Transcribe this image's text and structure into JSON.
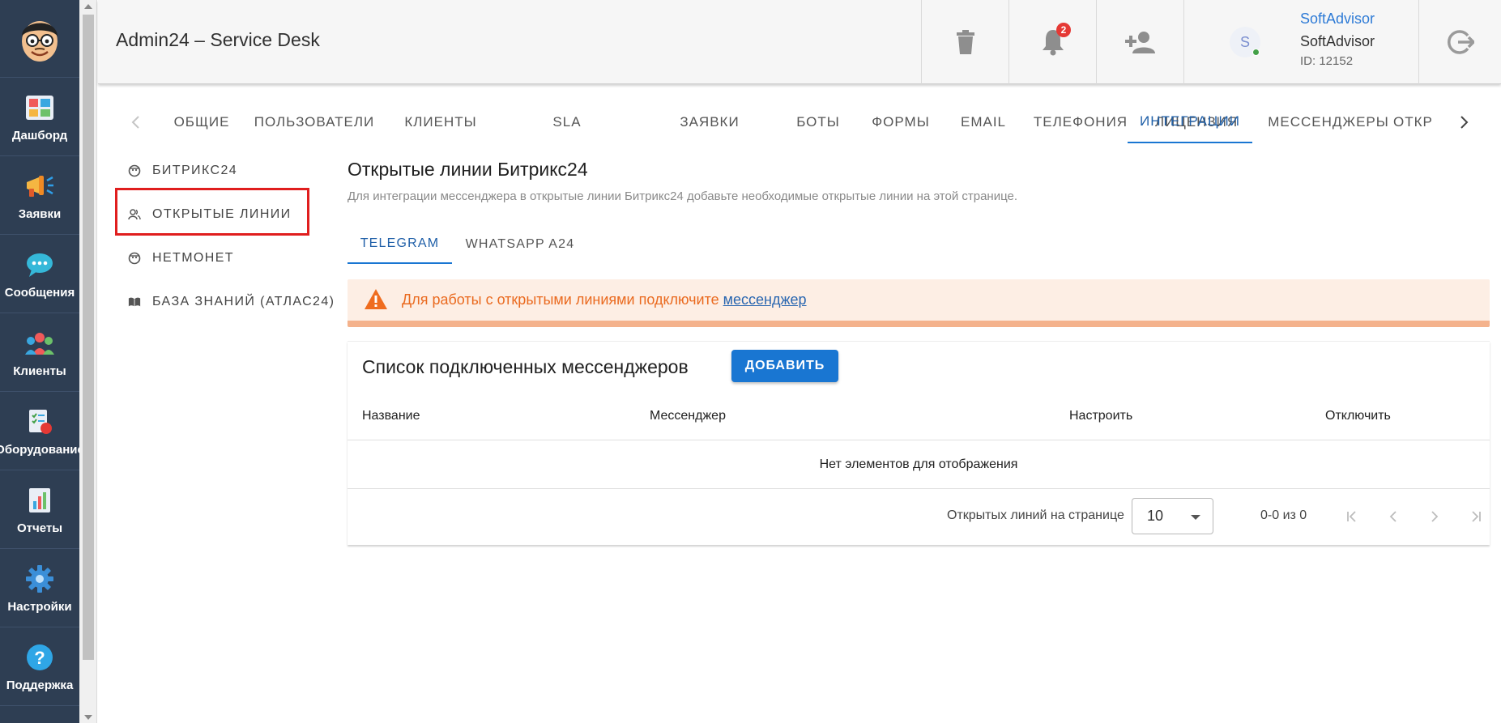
{
  "app": {
    "title": "Admin24 – Service Desk"
  },
  "sidebar": {
    "items": [
      {
        "label": "Дашборд",
        "icon": "dashboard-icon"
      },
      {
        "label": "Заявки",
        "icon": "megaphone-icon"
      },
      {
        "label": "Сообщения",
        "icon": "chat-bubble-icon"
      },
      {
        "label": "Клиенты",
        "icon": "clients-group-icon"
      },
      {
        "label": "Оборудование",
        "icon": "equipment-checklist-icon"
      },
      {
        "label": "Отчеты",
        "icon": "report-chart-icon"
      },
      {
        "label": "Настройки",
        "icon": "gear-icon"
      },
      {
        "label": "Поддержка",
        "icon": "help-icon"
      }
    ]
  },
  "header": {
    "notifications_count": "2",
    "user": {
      "avatar_letter": "S",
      "link_name": "SoftAdvisor",
      "name": "SoftAdvisor",
      "id": "ID: 12152"
    }
  },
  "tabs": [
    "ОБЩИЕ",
    "ПОЛЬЗОВАТЕЛИ",
    "КЛИЕНТЫ",
    "SLA",
    "ЗАЯВКИ",
    "БОТЫ",
    "ФОРМЫ",
    "EMAIL",
    "ТЕЛЕФОНИЯ",
    "ЛИЦЕНЗИЯ",
    "ИНТЕГРАЦИИ",
    "МЕССЕНДЖЕРЫ",
    "ОТКР"
  ],
  "active_tab": "ИНТЕГРАЦИИ",
  "subnav": [
    {
      "label": "БИТРИКС24",
      "icon": "bitrix-icon"
    },
    {
      "label": "ОТКРЫТЫЕ ЛИНИИ",
      "icon": "users-icon"
    },
    {
      "label": "НЕТМОНЕТ",
      "icon": "netmonet-icon"
    },
    {
      "label": "БАЗА ЗНАНИЙ (АТЛАС24)",
      "icon": "book-icon"
    }
  ],
  "content": {
    "title": "Открытые линии Битрикс24",
    "description": "Для интеграции мессенджера в открытые линии Битрикс24 добавьте необходимые открытые линии на этой странице.",
    "inner_tabs": [
      "TELEGRAM",
      "WHATSAPP A24"
    ],
    "alert": {
      "text": "Для работы с открытыми линиями подключите ",
      "link": "мессенджер"
    },
    "list": {
      "title": "Список подключенных мессенджеров",
      "add_button": "ДОБАВИТЬ",
      "columns": [
        "Название",
        "Мессенджер",
        "Настроить",
        "Отключить"
      ],
      "empty_text": "Нет элементов для отображения",
      "rows_per_page_label": "Открытых линий на странице",
      "rows_per_page": "10",
      "range": "0-0 из 0"
    }
  },
  "colors": {
    "sidebar_bg": "#2e3e53",
    "accent": "#1976d2",
    "alert_text": "#ea6a1f",
    "alert_bg": "#fdeee4"
  }
}
